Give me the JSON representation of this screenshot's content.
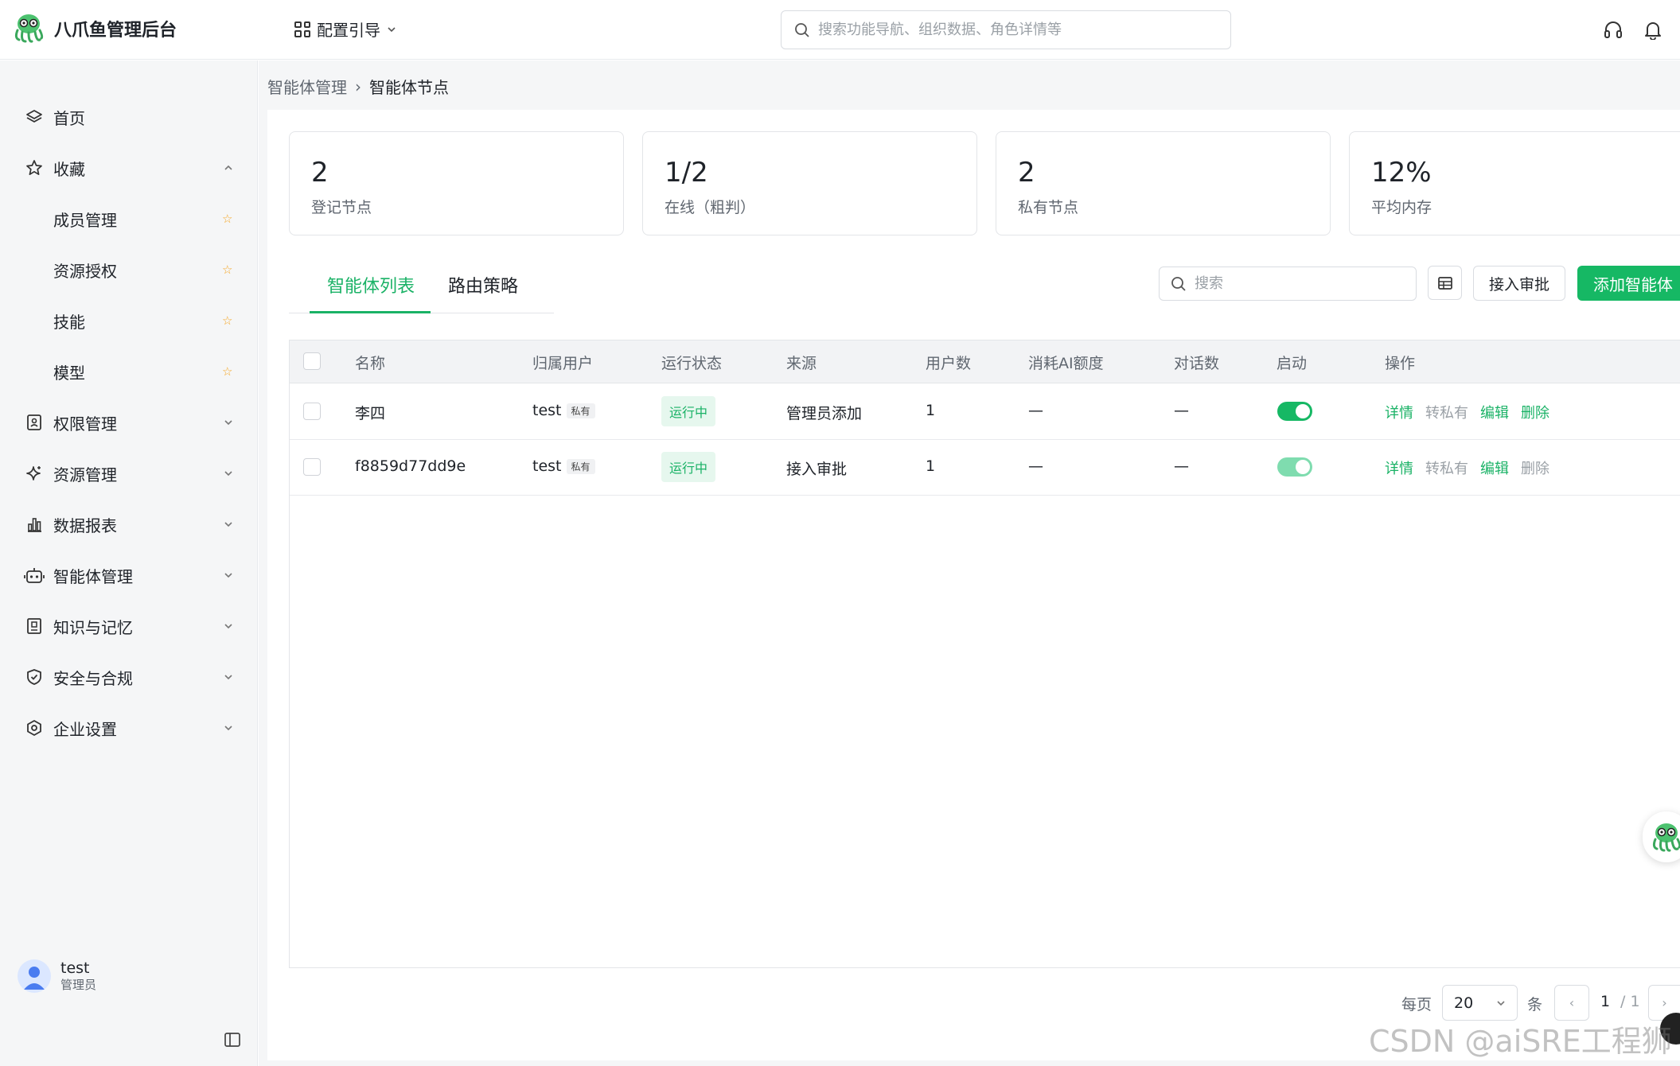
{
  "header": {
    "app_name": "八爪鱼管理后台",
    "guide_label": "配置引导",
    "search_placeholder": "搜索功能导航、组织数据、角色详情等"
  },
  "sidebar": {
    "items": [
      {
        "label": "首页",
        "icon": "layers-icon"
      },
      {
        "label": "收藏",
        "icon": "star-icon",
        "expanded": true
      },
      {
        "label": "成员管理",
        "favorite": true
      },
      {
        "label": "资源授权",
        "favorite": true
      },
      {
        "label": "技能",
        "favorite": true
      },
      {
        "label": "模型",
        "favorite": true
      },
      {
        "label": "权限管理",
        "icon": "id-card-icon"
      },
      {
        "label": "资源管理",
        "icon": "sparkle-icon"
      },
      {
        "label": "数据报表",
        "icon": "bar-chart-icon"
      },
      {
        "label": "智能体管理",
        "icon": "robot-icon"
      },
      {
        "label": "知识与记忆",
        "icon": "book-icon"
      },
      {
        "label": "安全与合规",
        "icon": "shield-icon"
      },
      {
        "label": "企业设置",
        "icon": "settings-icon"
      }
    ],
    "user": {
      "name": "test",
      "role": "管理员"
    }
  },
  "breadcrumb": {
    "parent": "智能体管理",
    "separator": "›",
    "current": "智能体节点"
  },
  "stats": [
    {
      "value": "2",
      "label": "登记节点"
    },
    {
      "value": "1/2",
      "label": "在线（粗判）"
    },
    {
      "value": "2",
      "label": "私有节点"
    },
    {
      "value": "12%",
      "label": "平均内存"
    }
  ],
  "tabs": [
    {
      "label": "智能体列表",
      "active": true
    },
    {
      "label": "路由策略",
      "active": false
    }
  ],
  "toolbar": {
    "search_placeholder": "搜索",
    "approve_label": "接入审批",
    "add_label": "添加智能体"
  },
  "table": {
    "columns": [
      "名称",
      "归属用户",
      "运行状态",
      "来源",
      "用户数",
      "消耗AI额度",
      "对话数",
      "启动",
      "操作"
    ],
    "rows": [
      {
        "name": "李四",
        "owner": "test",
        "owner_tag": "私有",
        "status": "运行中",
        "source": "管理员添加",
        "users": "1",
        "ai_quota": "—",
        "conversations": "—",
        "enabled": true,
        "actions": {
          "detail": "详情",
          "to_private": "转私有",
          "edit": "编辑",
          "delete": "删除"
        }
      },
      {
        "name": "f8859d77dd9e",
        "owner": "test",
        "owner_tag": "私有",
        "status": "运行中",
        "source": "接入审批",
        "users": "1",
        "ai_quota": "—",
        "conversations": "—",
        "enabled": true,
        "actions": {
          "detail": "详情",
          "to_private": "转私有",
          "edit": "编辑",
          "delete": "删除"
        }
      }
    ]
  },
  "pagination": {
    "per_page_label": "每页",
    "page_size": "20",
    "unit_label": "条",
    "current_page": "1",
    "total_pages": "/ 1",
    "prev": "‹",
    "next": "›"
  },
  "watermark": "CSDN @aiSRE工程狮",
  "colors": {
    "accent": "#16b864",
    "accent_text": "#1ab266",
    "tag_bg": "#e6f7ee"
  }
}
